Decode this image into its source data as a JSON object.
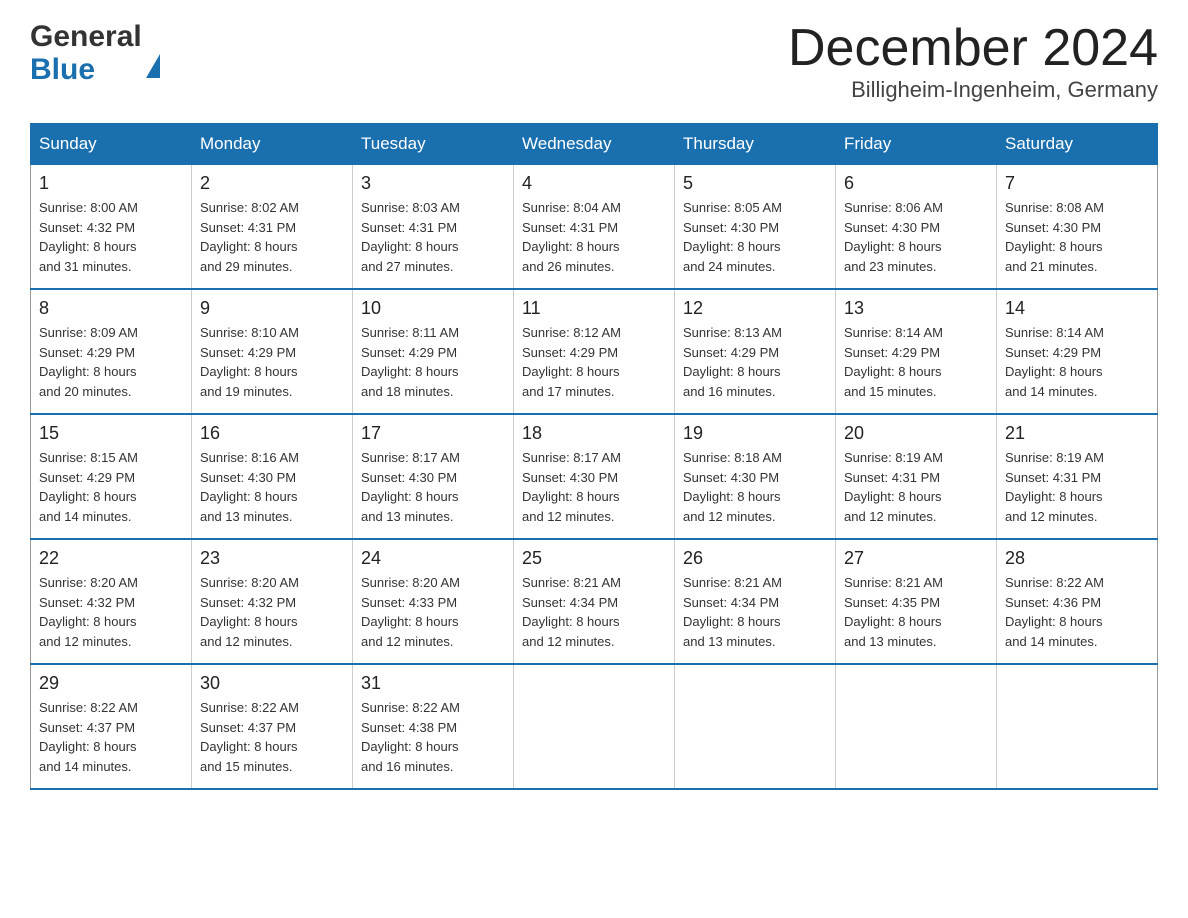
{
  "header": {
    "logo_general": "General",
    "logo_blue": "Blue",
    "month_title": "December 2024",
    "location": "Billigheim-Ingenheim, Germany"
  },
  "calendar": {
    "weekdays": [
      "Sunday",
      "Monday",
      "Tuesday",
      "Wednesday",
      "Thursday",
      "Friday",
      "Saturday"
    ],
    "weeks": [
      [
        {
          "day": "1",
          "sunrise": "8:00 AM",
          "sunset": "4:32 PM",
          "daylight": "8 hours and 31 minutes."
        },
        {
          "day": "2",
          "sunrise": "8:02 AM",
          "sunset": "4:31 PM",
          "daylight": "8 hours and 29 minutes."
        },
        {
          "day": "3",
          "sunrise": "8:03 AM",
          "sunset": "4:31 PM",
          "daylight": "8 hours and 27 minutes."
        },
        {
          "day": "4",
          "sunrise": "8:04 AM",
          "sunset": "4:31 PM",
          "daylight": "8 hours and 26 minutes."
        },
        {
          "day": "5",
          "sunrise": "8:05 AM",
          "sunset": "4:30 PM",
          "daylight": "8 hours and 24 minutes."
        },
        {
          "day": "6",
          "sunrise": "8:06 AM",
          "sunset": "4:30 PM",
          "daylight": "8 hours and 23 minutes."
        },
        {
          "day": "7",
          "sunrise": "8:08 AM",
          "sunset": "4:30 PM",
          "daylight": "8 hours and 21 minutes."
        }
      ],
      [
        {
          "day": "8",
          "sunrise": "8:09 AM",
          "sunset": "4:29 PM",
          "daylight": "8 hours and 20 minutes."
        },
        {
          "day": "9",
          "sunrise": "8:10 AM",
          "sunset": "4:29 PM",
          "daylight": "8 hours and 19 minutes."
        },
        {
          "day": "10",
          "sunrise": "8:11 AM",
          "sunset": "4:29 PM",
          "daylight": "8 hours and 18 minutes."
        },
        {
          "day": "11",
          "sunrise": "8:12 AM",
          "sunset": "4:29 PM",
          "daylight": "8 hours and 17 minutes."
        },
        {
          "day": "12",
          "sunrise": "8:13 AM",
          "sunset": "4:29 PM",
          "daylight": "8 hours and 16 minutes."
        },
        {
          "day": "13",
          "sunrise": "8:14 AM",
          "sunset": "4:29 PM",
          "daylight": "8 hours and 15 minutes."
        },
        {
          "day": "14",
          "sunrise": "8:14 AM",
          "sunset": "4:29 PM",
          "daylight": "8 hours and 14 minutes."
        }
      ],
      [
        {
          "day": "15",
          "sunrise": "8:15 AM",
          "sunset": "4:29 PM",
          "daylight": "8 hours and 14 minutes."
        },
        {
          "day": "16",
          "sunrise": "8:16 AM",
          "sunset": "4:30 PM",
          "daylight": "8 hours and 13 minutes."
        },
        {
          "day": "17",
          "sunrise": "8:17 AM",
          "sunset": "4:30 PM",
          "daylight": "8 hours and 13 minutes."
        },
        {
          "day": "18",
          "sunrise": "8:17 AM",
          "sunset": "4:30 PM",
          "daylight": "8 hours and 12 minutes."
        },
        {
          "day": "19",
          "sunrise": "8:18 AM",
          "sunset": "4:30 PM",
          "daylight": "8 hours and 12 minutes."
        },
        {
          "day": "20",
          "sunrise": "8:19 AM",
          "sunset": "4:31 PM",
          "daylight": "8 hours and 12 minutes."
        },
        {
          "day": "21",
          "sunrise": "8:19 AM",
          "sunset": "4:31 PM",
          "daylight": "8 hours and 12 minutes."
        }
      ],
      [
        {
          "day": "22",
          "sunrise": "8:20 AM",
          "sunset": "4:32 PM",
          "daylight": "8 hours and 12 minutes."
        },
        {
          "day": "23",
          "sunrise": "8:20 AM",
          "sunset": "4:32 PM",
          "daylight": "8 hours and 12 minutes."
        },
        {
          "day": "24",
          "sunrise": "8:20 AM",
          "sunset": "4:33 PM",
          "daylight": "8 hours and 12 minutes."
        },
        {
          "day": "25",
          "sunrise": "8:21 AM",
          "sunset": "4:34 PM",
          "daylight": "8 hours and 12 minutes."
        },
        {
          "day": "26",
          "sunrise": "8:21 AM",
          "sunset": "4:34 PM",
          "daylight": "8 hours and 13 minutes."
        },
        {
          "day": "27",
          "sunrise": "8:21 AM",
          "sunset": "4:35 PM",
          "daylight": "8 hours and 13 minutes."
        },
        {
          "day": "28",
          "sunrise": "8:22 AM",
          "sunset": "4:36 PM",
          "daylight": "8 hours and 14 minutes."
        }
      ],
      [
        {
          "day": "29",
          "sunrise": "8:22 AM",
          "sunset": "4:37 PM",
          "daylight": "8 hours and 14 minutes."
        },
        {
          "day": "30",
          "sunrise": "8:22 AM",
          "sunset": "4:37 PM",
          "daylight": "8 hours and 15 minutes."
        },
        {
          "day": "31",
          "sunrise": "8:22 AM",
          "sunset": "4:38 PM",
          "daylight": "8 hours and 16 minutes."
        },
        null,
        null,
        null,
        null
      ]
    ]
  }
}
